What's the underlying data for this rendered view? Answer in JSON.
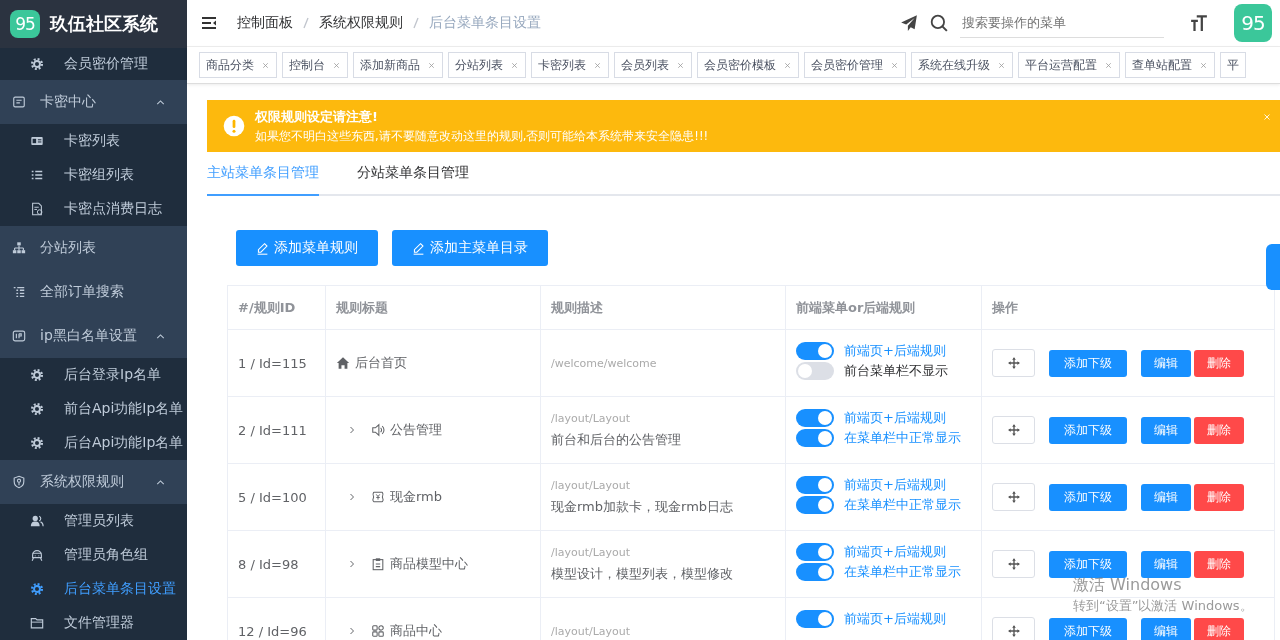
{
  "sidebar": {
    "logo_mark": "95",
    "title": "玖伍社区系统",
    "items": [
      {
        "children": [
          {
            "label": "会员密价管理",
            "selected": false
          }
        ]
      },
      {
        "label": "卡密中心",
        "expanded": true,
        "children": [
          {
            "label": "卡密列表",
            "selected": false
          },
          {
            "label": "卡密组列表",
            "selected": false
          },
          {
            "label": "卡密点消费日志",
            "selected": false
          }
        ]
      },
      {
        "label": "分站列表",
        "selected": false
      },
      {
        "label": "全部订单搜索",
        "selected": false
      },
      {
        "label": "ip黑白名单设置",
        "expanded": true,
        "children": [
          {
            "label": "后台登录Ip名单",
            "selected": false
          },
          {
            "label": "前台Api功能Ip名单",
            "selected": false
          },
          {
            "label": "后台Api功能Ip名单",
            "selected": false
          }
        ]
      },
      {
        "label": "系统权限规则",
        "expanded": true,
        "children": [
          {
            "label": "管理员列表",
            "selected": false
          },
          {
            "label": "管理员角色组",
            "selected": false
          },
          {
            "label": "后台菜单条目设置",
            "selected": true
          },
          {
            "label": "文件管理器",
            "selected": false
          }
        ]
      }
    ]
  },
  "header": {
    "breadcrumb": [
      "控制面板",
      "系统权限规则",
      "后台菜单条目设置"
    ],
    "search": {
      "placeholder": "搜索要操作的菜单"
    },
    "avatar_mark": "95"
  },
  "tags": [
    "商品分类",
    "控制台",
    "添加新商品",
    "分站列表",
    "卡密列表",
    "会员列表",
    "会员密价模板",
    "会员密价管理",
    "系统在线升级",
    "平台运营配置",
    "查单站配置",
    "平"
  ],
  "alert": {
    "title": "权限规则设定请注意!",
    "message": "如果您不明白这些东西,请不要随意改动这里的规则,否则可能给本系统带来安全隐患!!!"
  },
  "tabs": [
    {
      "label": "主站菜单条目管理",
      "selected": true
    },
    {
      "label": "分站菜单条目管理",
      "selected": false
    }
  ],
  "buttons": [
    "添加菜单规则",
    "添加主菜单目录"
  ],
  "table": {
    "columns": [
      "#/规则ID",
      "规则标题",
      "规则描述",
      "前端菜单or后端规则",
      "操作"
    ],
    "rows": [
      {
        "id": "1 / Id=115",
        "title": "后台首页",
        "path": "/welcome/welcome",
        "switches": [
          {
            "label": "前端页+后端规则",
            "on": true
          },
          {
            "label": "前台菜单栏不显示",
            "on": false
          }
        ],
        "actions": [
          {
            "label": "添加下级",
            "kind": "primary"
          },
          {
            "label": "编辑",
            "kind": "primary"
          },
          {
            "label": "删除",
            "kind": "danger"
          }
        ]
      },
      {
        "id": "2 / Id=111",
        "title": "公告管理",
        "expanded": false,
        "path": "/layout/Layout",
        "desc": "前台和后台的公告管理",
        "switches": [
          {
            "label": "前端页+后端规则",
            "on": true
          },
          {
            "label": "在菜单栏中正常显示",
            "on": true
          }
        ],
        "actions": [
          {
            "label": "添加下级",
            "kind": "primary"
          },
          {
            "label": "编辑",
            "kind": "primary"
          },
          {
            "label": "删除",
            "kind": "danger"
          }
        ]
      },
      {
        "id": "5 / Id=100",
        "title": "现金rmb",
        "expanded": false,
        "path": "/layout/Layout",
        "desc": "现金rmb加款卡，现金rmb日志",
        "switches": [
          {
            "label": "前端页+后端规则",
            "on": true
          },
          {
            "label": "在菜单栏中正常显示",
            "on": true
          }
        ],
        "actions": [
          {
            "label": "添加下级",
            "kind": "primary"
          },
          {
            "label": "编辑",
            "kind": "primary"
          },
          {
            "label": "删除",
            "kind": "danger"
          }
        ]
      },
      {
        "id": "8 / Id=98",
        "title": "商品模型中心",
        "expanded": false,
        "path": "/layout/Layout",
        "desc": "模型设计，模型列表，模型修改",
        "switches": [
          {
            "label": "前端页+后端规则",
            "on": true
          },
          {
            "label": "在菜单栏中正常显示",
            "on": true
          }
        ],
        "actions": [
          {
            "label": "添加下级",
            "kind": "primary"
          },
          {
            "label": "编辑",
            "kind": "primary"
          },
          {
            "label": "删除",
            "kind": "danger"
          }
        ]
      },
      {
        "id": "12 / Id=96",
        "title": "商品中心",
        "expanded": false,
        "path": "/layout/Layout",
        "switches": [
          {
            "label": "前端页+后端规则",
            "on": true
          }
        ],
        "actions": [
          {
            "label": "添加下级",
            "kind": "primary"
          },
          {
            "label": "编辑",
            "kind": "primary"
          },
          {
            "label": "删除",
            "kind": "danger"
          }
        ]
      }
    ]
  },
  "windows_notice": {
    "title": "激活 Windows",
    "message": "转到“设置”以激活 Windows。"
  }
}
